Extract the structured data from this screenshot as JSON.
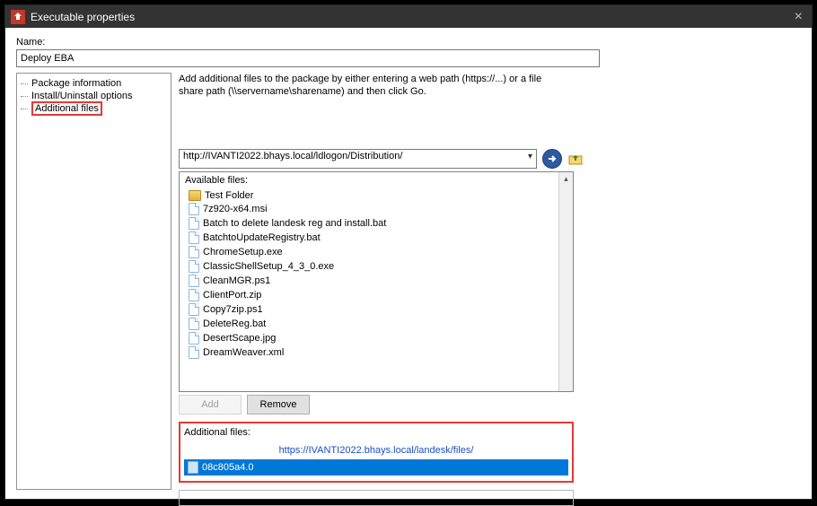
{
  "window": {
    "title": "Executable properties"
  },
  "name": {
    "label": "Name:",
    "value": "Deploy EBA"
  },
  "tree": {
    "items": [
      {
        "label": "Package information",
        "selected": false
      },
      {
        "label": "Install/Uninstall options",
        "selected": false
      },
      {
        "label": "Additional files",
        "selected": true
      }
    ]
  },
  "instructions": "Add additional files to the package by either entering a web path (https://...) or a file share path (\\\\servername\\sharename) and then click Go.",
  "path": {
    "value": "http://IVANTI2022.bhays.local/ldlogon/Distribution/"
  },
  "available": {
    "title": "Available files:",
    "items": [
      {
        "type": "folder",
        "name": "Test Folder"
      },
      {
        "type": "file",
        "name": "7z920-x64.msi"
      },
      {
        "type": "file",
        "name": "Batch to delete landesk reg and install.bat"
      },
      {
        "type": "file",
        "name": "BatchtoUpdateRegistry.bat"
      },
      {
        "type": "file",
        "name": "ChromeSetup.exe"
      },
      {
        "type": "file",
        "name": "ClassicShellSetup_4_3_0.exe"
      },
      {
        "type": "file",
        "name": "CleanMGR.ps1"
      },
      {
        "type": "file",
        "name": "ClientPort.zip"
      },
      {
        "type": "file",
        "name": "Copy7zip.ps1"
      },
      {
        "type": "file",
        "name": "DeleteReg.bat"
      },
      {
        "type": "file",
        "name": "DesertScape.jpg"
      },
      {
        "type": "file",
        "name": "DreamWeaver.xml"
      }
    ]
  },
  "buttons": {
    "add": "Add",
    "remove": "Remove"
  },
  "additional": {
    "title": "Additional files:",
    "url": "https://IVANTI2022.bhays.local/landesk/files/",
    "items": [
      {
        "name": "08c805a4.0"
      }
    ]
  }
}
